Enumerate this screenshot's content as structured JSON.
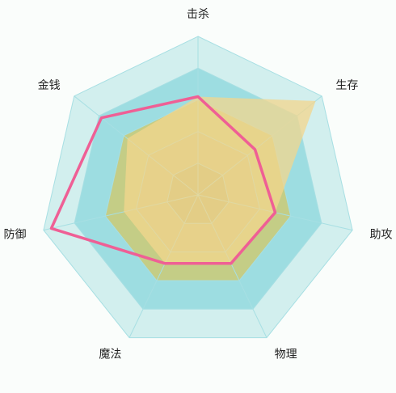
{
  "chart_data": {
    "type": "radar",
    "indicators": [
      {
        "name": "击杀",
        "max": 100
      },
      {
        "name": "生存",
        "max": 100
      },
      {
        "name": "助攻",
        "max": 100
      },
      {
        "name": "物理",
        "max": 100
      },
      {
        "name": "魔法",
        "max": 100
      },
      {
        "name": "防御",
        "max": 100
      },
      {
        "name": "金钱",
        "max": 100
      }
    ],
    "split_number": 5,
    "series": [
      {
        "values": [
          62,
          95,
          50,
          48,
          48,
          48,
          57
        ],
        "color": "#f3d58c",
        "style": "area"
      },
      {
        "values": [
          62,
          46,
          50,
          48,
          48,
          95,
          78
        ],
        "color": "#ef5f95",
        "style": "line"
      }
    ],
    "split_area_colors": [
      "#b4b274",
      "#c3c484",
      "#c4cd86",
      "#9ddde1",
      "#d2efee"
    ],
    "split_line_color": "#a7dfe3",
    "background": "#fafdfb"
  }
}
